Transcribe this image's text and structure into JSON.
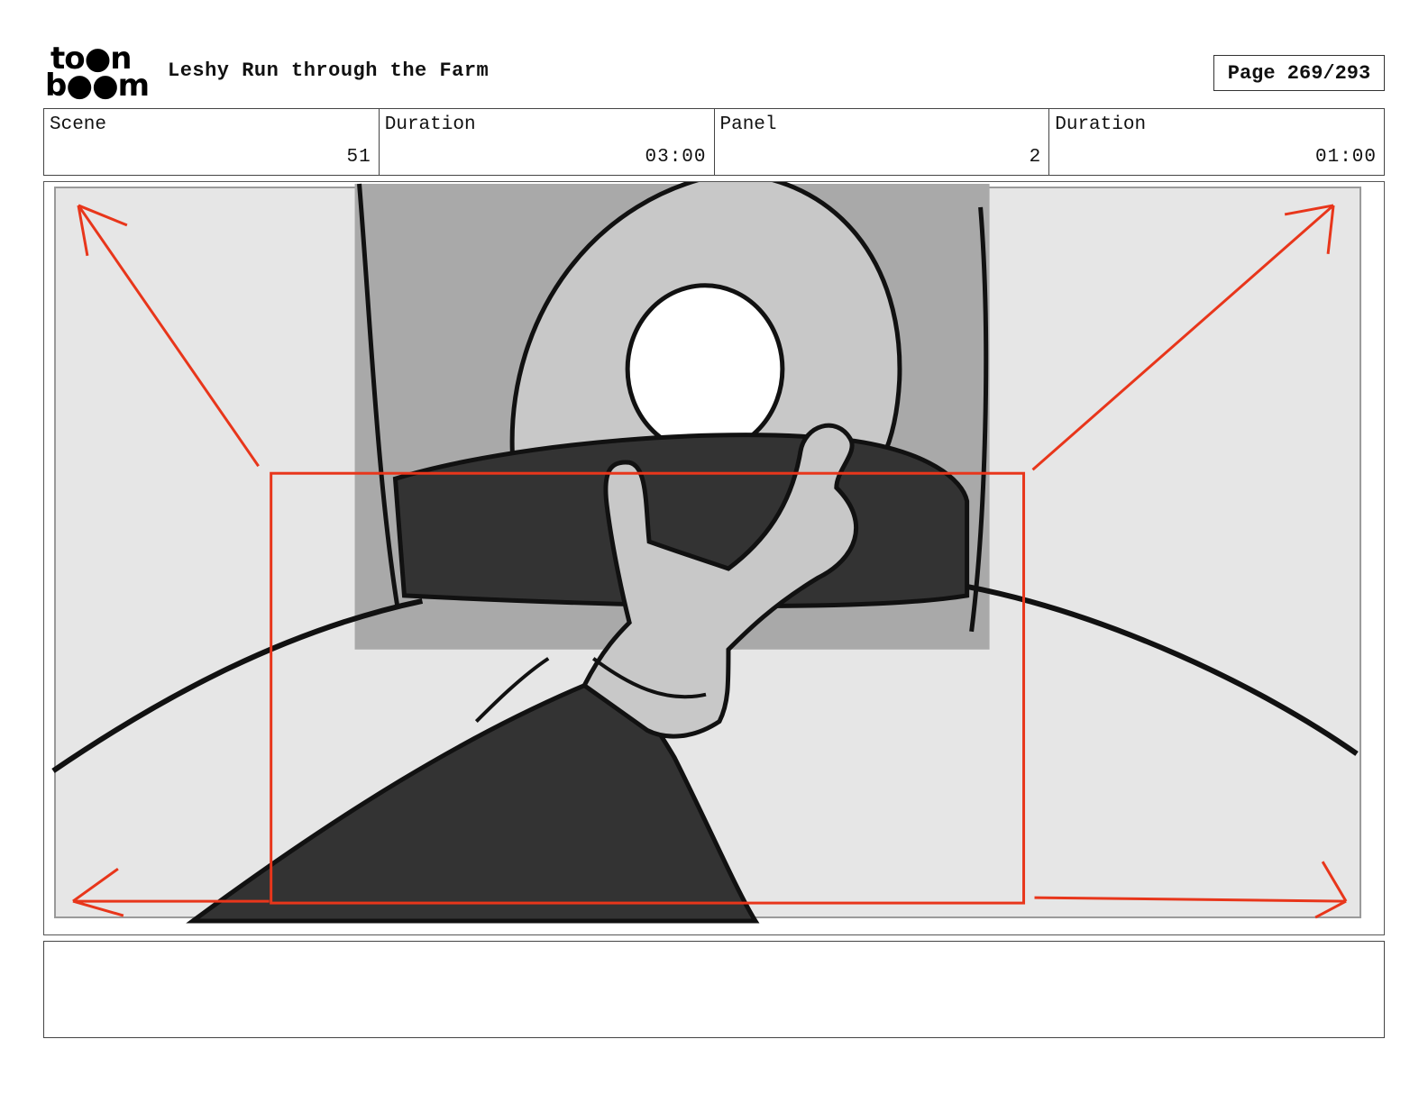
{
  "header": {
    "logo_line1": "to●n",
    "logo_line2": "b●●m",
    "title": "Leshy Run through the Farm",
    "page": "Page 269/293"
  },
  "info": {
    "scene_label": "Scene",
    "scene_value": "51",
    "scene_duration_label": "Duration",
    "scene_duration_value": "03:00",
    "panel_label": "Panel",
    "panel_value": "2",
    "panel_duration_label": "Duration",
    "panel_duration_value": "01:00"
  },
  "colors": {
    "camera_marks": "#e8361b",
    "ink": "#111111",
    "dark_fill": "#333333",
    "mid_fill": "#c8c8c8",
    "light_fill": "#e6e6e6"
  },
  "notes": {
    "text": ""
  }
}
